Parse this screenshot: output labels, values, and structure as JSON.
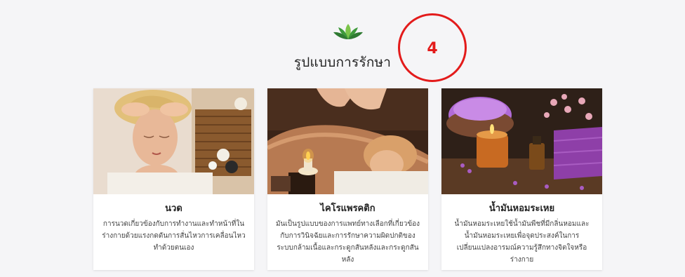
{
  "section": {
    "title": "รูปแบบการรักษา",
    "annotation_number": "4",
    "icon": "lotus-icon"
  },
  "colors": {
    "annotation": "#e31b1b",
    "leaf_dark": "#2f8a3a",
    "leaf_light": "#7cc44a"
  },
  "cards": [
    {
      "title": "นวด",
      "description": "การนวดเกี่ยวข้องกับการทำงานและทำหน้าที่ในร่างกายด้วยแรงกดดันการสั่นไหวการเคลื่อนไหวทำด้วยตนเอง",
      "image": "massage-face-photo"
    },
    {
      "title": "ไคโรแพรคติก",
      "description": "มันเป็นรูปแบบของการแพทย์ทางเลือกที่เกี่ยวข้องกับการวินิจฉัยและการรักษาความผิดปกติของระบบกล้ามเนื้อและกระดูกสันหลังและกระดูกสันหลัง",
      "image": "back-massage-photo"
    },
    {
      "title": "น้ำมันหอมระเหย",
      "description": "น้ำมันหอมระเหยใช้น้ำมันพืชที่มีกลิ่นหอมและน้ำมันหอมระเหยเพื่อจุดประสงค์ในการเปลี่ยนแปลงอารมณ์ความรู้สึกทางจิตใจหรือร่างกาย",
      "image": "aromatherapy-photo"
    }
  ]
}
